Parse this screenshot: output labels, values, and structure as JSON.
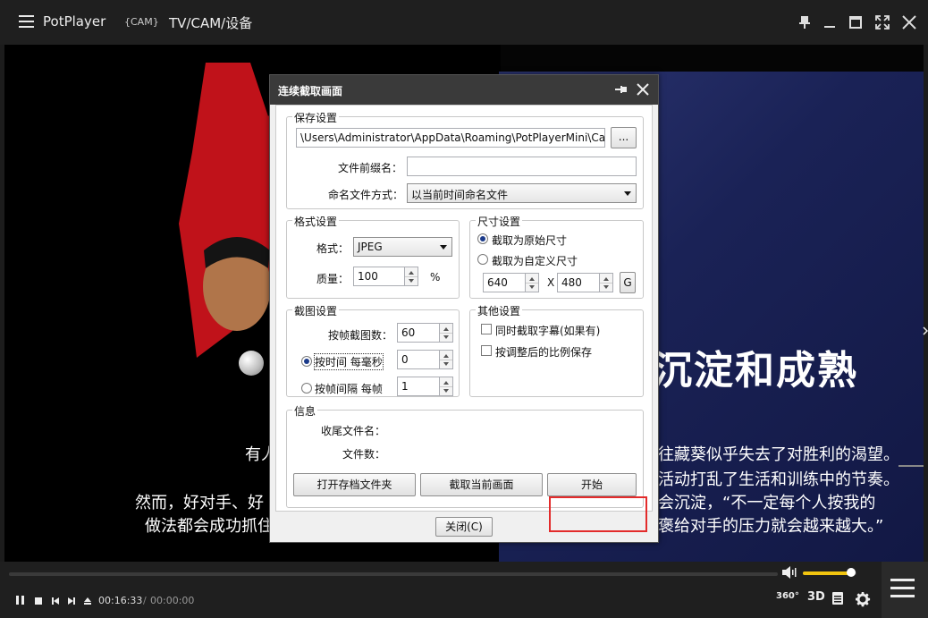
{
  "titlebar": {
    "app_name": "PotPlayer",
    "cam_tag": "{CAM}",
    "source": "TV/CAM/设备",
    "menu_icon": "hamburger-menu-icon",
    "buttons": [
      "pin-icon",
      "minimize-icon",
      "maximize-icon",
      "fullscreen-icon",
      "close-icon"
    ]
  },
  "video": {
    "slide_title": "沉淀和成熟",
    "subtitles_left": [
      "有人",
      "然而，好对手、好",
      "做法都会成功抓住"
    ],
    "subtitles_right": [
      "往藏葵似乎失去了对胜利的渴望。",
      "活动打乱了生活和训练中的节奏。",
      "会沉淀，“不一定每个人按我的",
      "褒给对手的压力就会越来越大。”"
    ]
  },
  "dialog": {
    "title": "连续截取画面",
    "save_settings": {
      "group_label": "保存设置",
      "path": "\\Users\\Administrator\\AppData\\Roaming\\PotPlayerMini\\Capture",
      "browse_label": "...",
      "prefix_label": "文件前缀名：",
      "prefix_value": "",
      "naming_label": "命名文件方式：",
      "naming_value": "以当前时间命名文件"
    },
    "format_settings": {
      "group_label": "格式设置",
      "format_label": "格式：",
      "format_value": "JPEG",
      "quality_label": "质量：",
      "quality_value": "100",
      "quality_unit": "%"
    },
    "size_settings": {
      "group_label": "尺寸设置",
      "original_label": "截取为原始尺寸",
      "custom_label": "截取为自定义尺寸",
      "width": "640",
      "x_label": "X",
      "height": "480",
      "g_label": "G",
      "selected": "original"
    },
    "capture_settings": {
      "group_label": "截图设置",
      "count_label": "按帧截图数：",
      "count_value": "60",
      "by_time_label": "按时间 每毫秒",
      "by_time_value": "0",
      "by_frame_label": "按帧间隔 每帧",
      "by_frame_value": "1",
      "selected": "by_time"
    },
    "other_settings": {
      "group_label": "其他设置",
      "subtitle_label": "同时截取字幕(如果有)",
      "ratio_label": "按调整后的比例保存"
    },
    "info": {
      "group_label": "信息",
      "last_file_label": "收尾文件名：",
      "file_count_label": "文件数："
    },
    "buttons": {
      "open_folder": "打开存档文件夹",
      "capture_now": "截取当前画面",
      "start": "开始",
      "close": "关闭(C)"
    }
  },
  "controls": {
    "time_current": "00:16:33",
    "time_separator": "/",
    "time_total": "00:00:00",
    "tag_360": "360°",
    "tag_3d": "3D",
    "volume_level": 0.9,
    "seek_position": 0
  }
}
